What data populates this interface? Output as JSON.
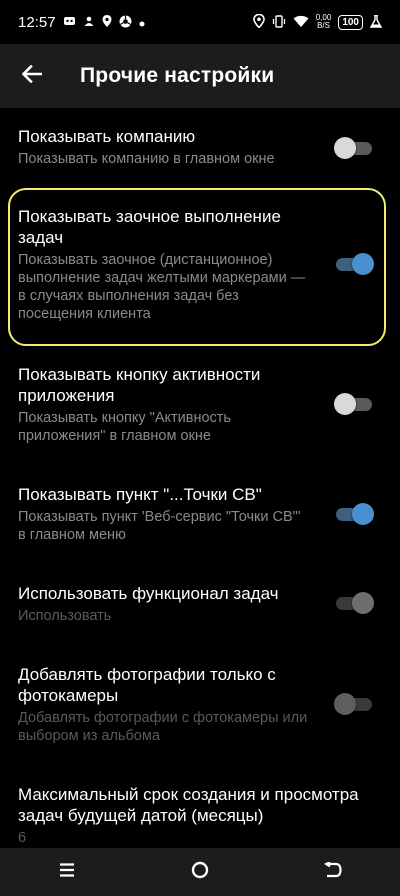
{
  "status_bar": {
    "time": "12:57",
    "speed": "0,00",
    "speed_unit": "B/S",
    "battery": "100"
  },
  "app_bar": {
    "title": "Прочие настройки",
    "back_icon": "arrow-left-icon"
  },
  "settings": [
    {
      "title": "Показывать компанию",
      "subtitle": "Показывать компанию в главном окне",
      "checked": false,
      "enabled": true
    },
    {
      "title": "Показывать заочное выполнение задач",
      "subtitle": "Показывать заочное (дистанционное) выполнение задач желтыми маркерами — в случаях выполнения задач без посещения клиента",
      "checked": true,
      "enabled": true,
      "highlighted": true
    },
    {
      "title": "Показывать кнопку активности приложения",
      "subtitle": "Показывать кнопку \"Активность приложения\" в главном окне",
      "checked": false,
      "enabled": true
    },
    {
      "title": "Показывать пункт \"...Точки СВ\"",
      "subtitle": "Показывать пункт 'Веб-сервис \"Точки СВ\"' в главном меню",
      "checked": true,
      "enabled": true
    },
    {
      "title": "Использовать функционал задач",
      "subtitle": "Использовать",
      "checked": true,
      "enabled": false
    },
    {
      "title": "Добавлять фотографии только с фотокамеры",
      "subtitle": "Добавлять фотографии с фотокамеры или выбором из альбома",
      "checked": false,
      "enabled": false
    },
    {
      "title": "Максимальный срок создания и просмотра задач будущей датой (месяцы)",
      "subtitle": "6"
    }
  ],
  "colors": {
    "accent": "#4a8fcf",
    "highlight": "#f1ee6a",
    "app_bar_bg": "#1c1c1c"
  },
  "nav_bar": {
    "icons": [
      "menu-icon",
      "home-circle-icon",
      "back-icon"
    ]
  }
}
